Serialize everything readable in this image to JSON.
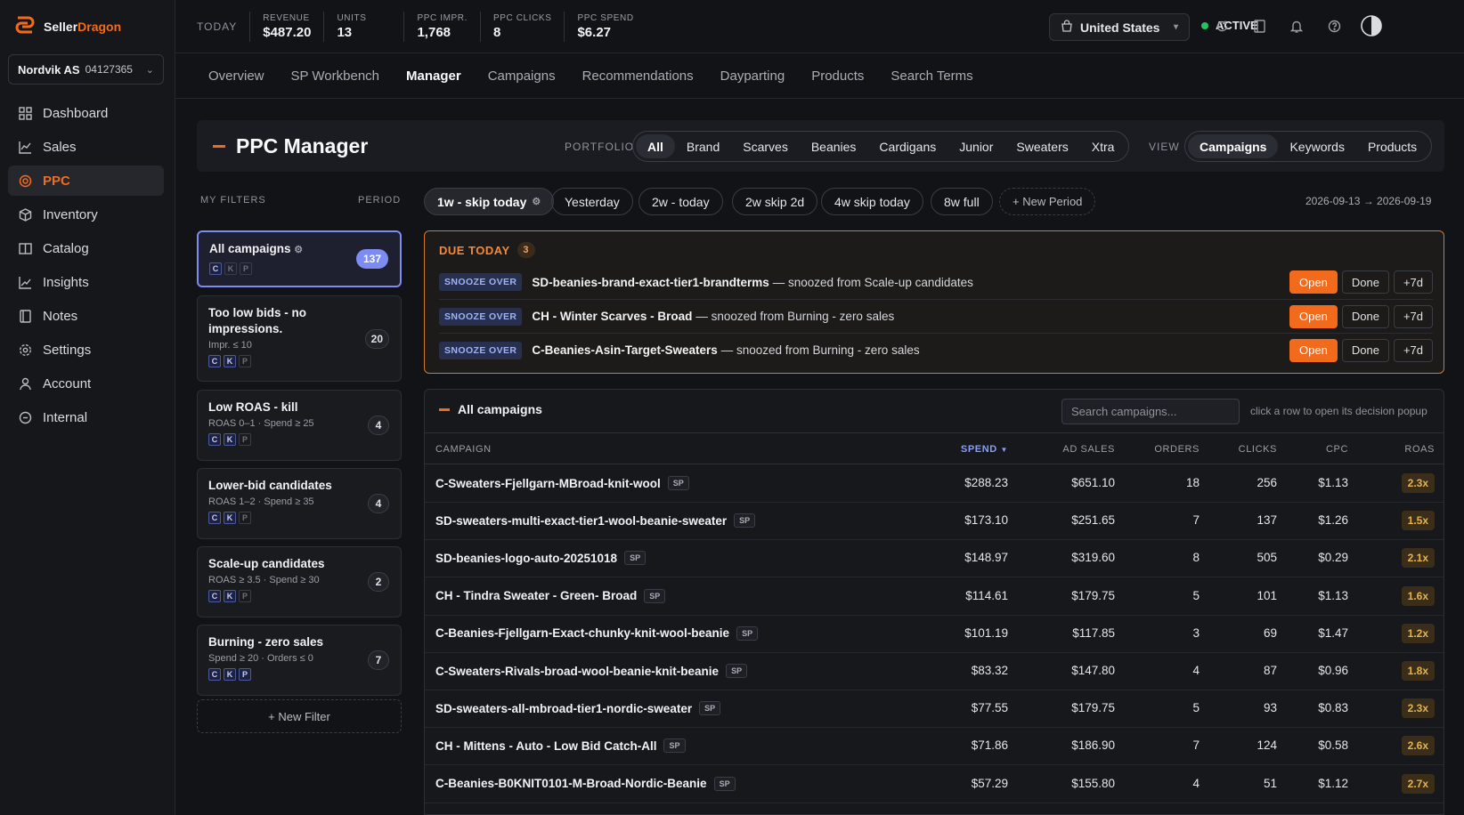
{
  "brand": {
    "part1": "Seller",
    "part2": "Dragon"
  },
  "account": {
    "name": "Nordvik AS",
    "id": "04127365"
  },
  "sidebar": {
    "items": [
      {
        "label": "Dashboard",
        "icon": "grid-icon"
      },
      {
        "label": "Sales",
        "icon": "chart-line-icon"
      },
      {
        "label": "PPC",
        "icon": "target-icon"
      },
      {
        "label": "Inventory",
        "icon": "box-icon"
      },
      {
        "label": "Catalog",
        "icon": "book-icon"
      },
      {
        "label": "Insights",
        "icon": "trend-icon"
      },
      {
        "label": "Notes",
        "icon": "note-icon"
      },
      {
        "label": "Settings",
        "icon": "gear-icon"
      },
      {
        "label": "Account",
        "icon": "user-icon"
      },
      {
        "label": "Internal",
        "icon": "clock-icon"
      }
    ]
  },
  "topbar": {
    "today_label": "TODAY",
    "kpis": [
      {
        "label": "REVENUE",
        "value": "$487.20"
      },
      {
        "label": "UNITS",
        "value": "13"
      },
      {
        "label": "PPC IMPR.",
        "value": "1,768"
      },
      {
        "label": "PPC CLICKS",
        "value": "8"
      },
      {
        "label": "PPC SPEND",
        "value": "$6.27"
      }
    ],
    "country": "United States",
    "status": "ACTIVE"
  },
  "tabs": [
    {
      "label": "Overview"
    },
    {
      "label": "SP Workbench"
    },
    {
      "label": "Manager",
      "active": true
    },
    {
      "label": "Campaigns"
    },
    {
      "label": "Recommendations"
    },
    {
      "label": "Dayparting"
    },
    {
      "label": "Products"
    },
    {
      "label": "Search Terms"
    }
  ],
  "header": {
    "title": "PPC Manager",
    "portfolio_label": "PORTFOLIO",
    "portfolios": [
      "All",
      "Brand",
      "Scarves",
      "Beanies",
      "Cardigans",
      "Junior",
      "Sweaters",
      "Xtra"
    ],
    "view_label": "VIEW",
    "views": [
      "Campaigns",
      "Keywords",
      "Products"
    ]
  },
  "filters": {
    "my_filters_label": "MY FILTERS",
    "period_label": "PERIOD",
    "items": [
      {
        "title": "All campaigns",
        "sub": "",
        "count": "137",
        "chips": [
          "C",
          "K",
          "P"
        ]
      },
      {
        "title": "Too low bids - no impressions.",
        "sub": "Impr. ≤ 10",
        "count": "20",
        "chips": [
          "C",
          "K",
          "P"
        ]
      },
      {
        "title": "Low ROAS - kill",
        "sub": "ROAS 0–1 · Spend ≥ 25",
        "count": "4",
        "chips": [
          "C",
          "K",
          "P"
        ]
      },
      {
        "title": "Lower-bid candidates",
        "sub": "ROAS 1–2 · Spend ≥ 35",
        "count": "4",
        "chips": [
          "C",
          "K",
          "P"
        ]
      },
      {
        "title": "Scale-up candidates",
        "sub": "ROAS ≥ 3.5 · Spend ≥ 30",
        "count": "2",
        "chips": [
          "C",
          "K",
          "P"
        ]
      },
      {
        "title": "Burning - zero sales",
        "sub": "Spend ≥ 20 · Orders ≤ 0",
        "count": "7",
        "chips": [
          "C",
          "K",
          "P"
        ]
      }
    ],
    "new_filter": "+ New Filter"
  },
  "periods": {
    "items": [
      "1w - skip today",
      "Yesterday",
      "2w - today",
      "2w skip 2d",
      "4w skip today",
      "8w full"
    ],
    "new_period": "+ New Period",
    "range": "2026-09-13 → 2026-09-19"
  },
  "due_today": {
    "label": "DUE TODAY",
    "count": "3",
    "rows": [
      {
        "tag": "SNOOZE OVER",
        "name": "SD-beanies-brand-exact-tier1-brandterms",
        "note": "— snoozed from Scale-up candidates"
      },
      {
        "tag": "SNOOZE OVER",
        "name": "CH - Winter Scarves - Broad",
        "note": "— snoozed from Burning - zero sales"
      },
      {
        "tag": "SNOOZE OVER",
        "name": "C-Beanies-Asin-Target-Sweaters",
        "note": "— snoozed from Burning - zero sales"
      }
    ],
    "actions": {
      "open": "Open",
      "done": "Done",
      "snooze": "+7d"
    }
  },
  "campaigns": {
    "title": "All campaigns",
    "search_placeholder": "Search campaigns...",
    "hint": "click a row to open its decision popup",
    "columns": {
      "campaign": "CAMPAIGN",
      "spend": "SPEND",
      "ad_sales": "AD SALES",
      "orders": "ORDERS",
      "clicks": "CLICKS",
      "cpc": "CPC",
      "roas": "ROAS"
    },
    "rows": [
      {
        "name": "C-Sweaters-Fjellgarn-MBroad-knit-wool",
        "type": "SP",
        "spend": "$288.23",
        "ad_sales": "$651.10",
        "orders": "18",
        "clicks": "256",
        "cpc": "$1.13",
        "roas": "2.3x"
      },
      {
        "name": "SD-sweaters-multi-exact-tier1-wool-beanie-sweater",
        "type": "SP",
        "spend": "$173.10",
        "ad_sales": "$251.65",
        "orders": "7",
        "clicks": "137",
        "cpc": "$1.26",
        "roas": "1.5x"
      },
      {
        "name": "SD-beanies-logo-auto-20251018",
        "type": "SP",
        "spend": "$148.97",
        "ad_sales": "$319.60",
        "orders": "8",
        "clicks": "505",
        "cpc": "$0.29",
        "roas": "2.1x"
      },
      {
        "name": "CH - Tindra Sweater - Green- Broad",
        "type": "SP",
        "spend": "$114.61",
        "ad_sales": "$179.75",
        "orders": "5",
        "clicks": "101",
        "cpc": "$1.13",
        "roas": "1.6x"
      },
      {
        "name": "C-Beanies-Fjellgarn-Exact-chunky-knit-wool-beanie",
        "type": "SP",
        "spend": "$101.19",
        "ad_sales": "$117.85",
        "orders": "3",
        "clicks": "69",
        "cpc": "$1.47",
        "roas": "1.2x"
      },
      {
        "name": "C-Sweaters-Rivals-broad-wool-beanie-knit-beanie",
        "type": "SP",
        "spend": "$83.32",
        "ad_sales": "$147.80",
        "orders": "4",
        "clicks": "87",
        "cpc": "$0.96",
        "roas": "1.8x"
      },
      {
        "name": "SD-sweaters-all-mbroad-tier1-nordic-sweater",
        "type": "SP",
        "spend": "$77.55",
        "ad_sales": "$179.75",
        "orders": "5",
        "clicks": "93",
        "cpc": "$0.83",
        "roas": "2.3x"
      },
      {
        "name": "CH - Mittens - Auto - Low Bid Catch-All",
        "type": "SP",
        "spend": "$71.86",
        "ad_sales": "$186.90",
        "orders": "7",
        "clicks": "124",
        "cpc": "$0.58",
        "roas": "2.6x"
      },
      {
        "name": "C-Beanies-B0KNIT0101-M-Broad-Nordic-Beanie",
        "type": "SP",
        "spend": "$57.29",
        "ad_sales": "$155.80",
        "orders": "4",
        "clicks": "51",
        "cpc": "$1.12",
        "roas": "2.7x"
      }
    ]
  },
  "colors": {
    "accent": "#f26b1d",
    "selection": "#7c8cf0",
    "active_dot": "#22c55e"
  }
}
